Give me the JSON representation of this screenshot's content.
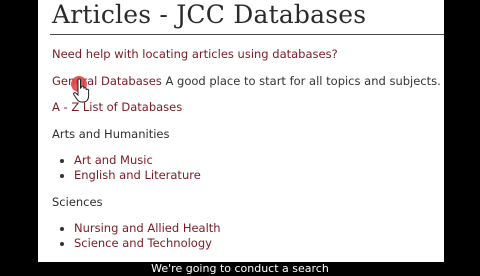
{
  "page": {
    "title": "Articles - JCC Databases",
    "help_link": "Need help with locating articles using databases?",
    "general_link": "General Databases",
    "general_desc": " A good place to start for all topics and subjects.",
    "az_link": "A - Z List of Databases",
    "sections": [
      {
        "heading": "Arts and Humanities",
        "items": [
          "Art and Music",
          "English and Literature"
        ]
      },
      {
        "heading": "Sciences",
        "items": [
          "Nursing and Allied Health",
          "Science and Technology"
        ]
      }
    ]
  },
  "caption": {
    "text": "We're going to conduct a search"
  },
  "colors": {
    "link": "#7a1a24",
    "click_marker": "#e23b3b"
  },
  "icons": {
    "cursor": "hand-pointer-icon"
  }
}
